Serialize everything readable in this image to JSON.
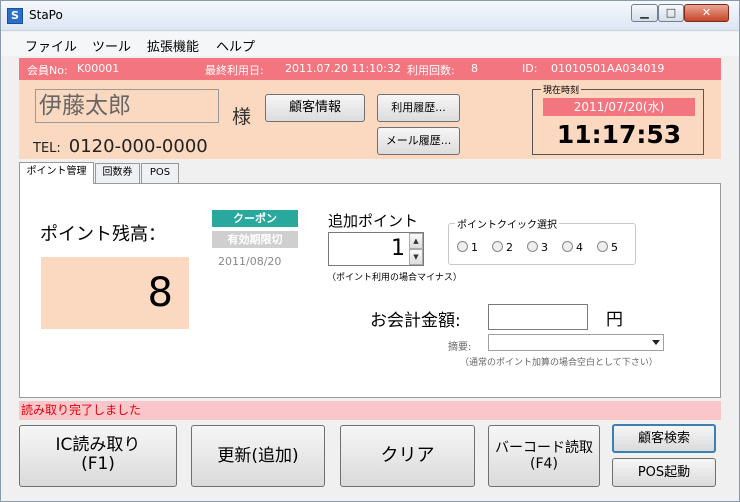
{
  "window": {
    "title": "StaPo",
    "icon": "S"
  },
  "menu": [
    "ファイル",
    "ツール",
    "拡張機能",
    "ヘルプ"
  ],
  "customer": {
    "member_no_label": "会員No:",
    "member_no": "K00001",
    "last_use_label": "最終利用日:",
    "last_use": "2011.07.20 11:10:32",
    "use_count_label": "利用回数:",
    "use_count": "8",
    "id_label": "ID:",
    "id": "01010501AA034019",
    "name": "伊藤太郎",
    "honorific": "様",
    "tel_label": "TEL:",
    "tel": "0120-000-0000",
    "info_button": "顧客情報",
    "history_button": "利用履歴...",
    "mail_button": "メール履歴..."
  },
  "current_time": {
    "legend": "現在時刻",
    "date": "2011/07/20(水)",
    "time": "11:17:53"
  },
  "tabs": [
    "ポイント管理",
    "回数券",
    "POS"
  ],
  "points": {
    "balance_label": "ポイント残高：",
    "balance": "8",
    "coupon_label": "クーポン",
    "expire_label": "有効期限切",
    "coupon_date": "2011/08/20",
    "add_label": "追加ポイント",
    "add_value": "1",
    "add_note": "（ポイント利用の場合マイナス）",
    "quick_label": "ポイントクイック選択",
    "quick_options": [
      "1",
      "2",
      "3",
      "4",
      "5"
    ],
    "payment_label": "お会計金額:",
    "payment_value": "",
    "yen": "円",
    "memo_label": "摘要:",
    "memo_note": "（通常のポイント加算の場合空白として下さい）"
  },
  "status_text": "読み取り完了しました",
  "buttons": {
    "ic_read_line1": "IC読み取り",
    "ic_read_line2": "(F1)",
    "update": "更新(追加)",
    "clear": "クリア",
    "barcode_line1": "バーコード読取",
    "barcode_line2": "(F4)",
    "search": "顧客検索",
    "pos": "POS起動"
  },
  "icons": {
    "minimize": "minimize-icon",
    "maximize": "maximize-icon",
    "close": "close-icon"
  }
}
